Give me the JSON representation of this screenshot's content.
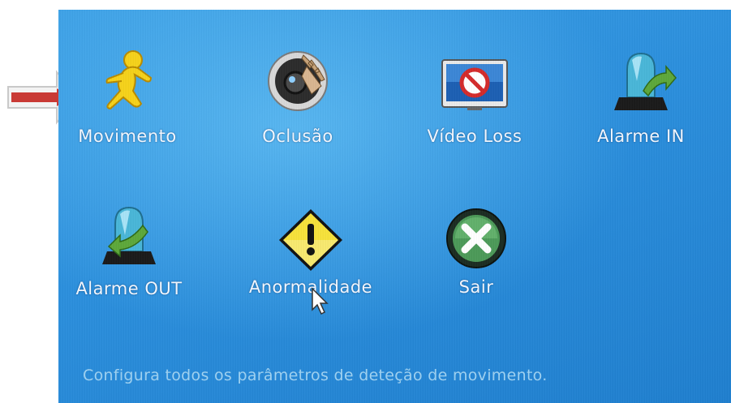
{
  "menu": {
    "items": [
      {
        "label": "Movimento",
        "icon": "running-man-icon"
      },
      {
        "label": "Oclusão",
        "icon": "camera-lens-occlusion-icon"
      },
      {
        "label": "Vídeo Loss",
        "icon": "video-loss-monitor-icon"
      },
      {
        "label": "Alarme IN",
        "icon": "alarm-in-siren-icon"
      },
      {
        "label": "Alarme OUT",
        "icon": "alarm-out-siren-icon"
      },
      {
        "label": "Anormalidade",
        "icon": "warning-diamond-icon"
      },
      {
        "label": "Sair",
        "icon": "exit-x-icon"
      }
    ]
  },
  "status_text": "Configura todos os parâmetros de deteção de movimento.",
  "colors": {
    "background": "#2b8fdd",
    "label": "#f4f8ff",
    "status": "#9fd2f2",
    "pointer_arrow": "#c93a35"
  }
}
